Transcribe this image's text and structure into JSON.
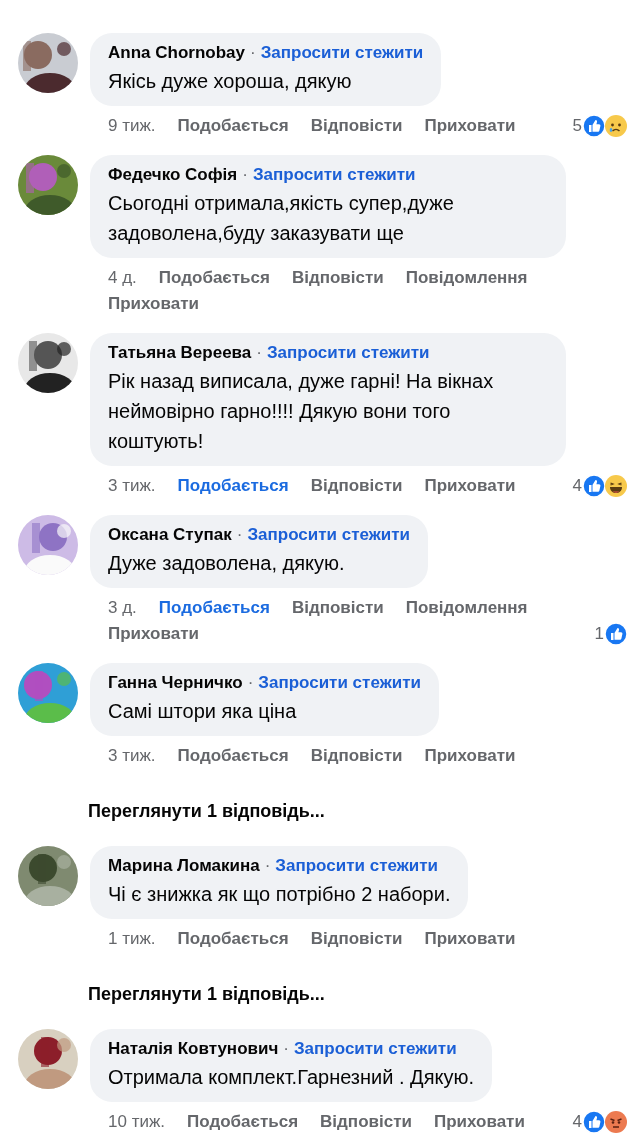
{
  "comments": [
    {
      "author": "Anna Chornobay",
      "separator": "·",
      "follow": "Запросити стежити",
      "text": "Якісь дуже хороша, дякую",
      "time": "9 тиж.",
      "liked": false,
      "actions": [
        {
          "kind": "like",
          "label": "Подобається"
        },
        {
          "kind": "reply",
          "label": "Відповісти"
        },
        {
          "kind": "hide",
          "label": "Приховати"
        }
      ],
      "reactions": {
        "count": "5",
        "icons": [
          {
            "kind": "like"
          },
          {
            "kind": "sad"
          }
        ]
      }
    },
    {
      "author": "Федечко Софія",
      "separator": "·",
      "follow": "Запросити стежити",
      "text": "Сьогодні отримала,якість супер,дуже задоволена,буду заказувати ще",
      "time": "4 д.",
      "liked": false,
      "actions": [
        {
          "kind": "like",
          "label": "Подобається"
        },
        {
          "kind": "reply",
          "label": "Відповісти"
        },
        {
          "kind": "message",
          "label": "Повідомлення"
        },
        {
          "kind": "hide",
          "label": "Приховати"
        }
      ]
    },
    {
      "author": "Татьяна Вереева",
      "separator": "·",
      "follow": "Запросити стежити",
      "text": "Рік назад виписала, дуже гарні! На вікнах неймовірно гарно!!!! Дякую вони того коштують!",
      "time": "3 тиж.",
      "liked": true,
      "actions": [
        {
          "kind": "like",
          "label": "Подобається"
        },
        {
          "kind": "reply",
          "label": "Відповісти"
        },
        {
          "kind": "hide",
          "label": "Приховати"
        }
      ],
      "reactions": {
        "count": "4",
        "icons": [
          {
            "kind": "like"
          },
          {
            "kind": "haha"
          }
        ]
      }
    },
    {
      "author": "Оксана Ступак",
      "separator": "·",
      "follow": "Запросити стежити",
      "text": "Дуже задоволена, дякую.",
      "time": "3 д.",
      "liked": true,
      "actions": [
        {
          "kind": "like",
          "label": "Подобається"
        },
        {
          "kind": "reply",
          "label": "Відповісти"
        },
        {
          "kind": "message",
          "label": "Повідомлення"
        },
        {
          "kind": "hide",
          "label": "Приховати"
        }
      ],
      "reactions": {
        "count": "1",
        "icons": [
          {
            "kind": "like"
          }
        ]
      }
    },
    {
      "author": "Ганна Черничко",
      "separator": "·",
      "follow": "Запросити стежити",
      "text": "Самі штори яка ціна",
      "time": "3 тиж.",
      "liked": false,
      "actions": [
        {
          "kind": "like",
          "label": "Подобається"
        },
        {
          "kind": "reply",
          "label": "Відповісти"
        },
        {
          "kind": "hide",
          "label": "Приховати"
        }
      ],
      "view_replies": "Переглянути 1 відповідь..."
    },
    {
      "author": "Марина Ломакина",
      "separator": "·",
      "follow": "Запросити стежити",
      "text": "Чі є знижка як що потрібно 2 набори.",
      "time": "1 тиж.",
      "liked": false,
      "actions": [
        {
          "kind": "like",
          "label": "Подобається"
        },
        {
          "kind": "reply",
          "label": "Відповісти"
        },
        {
          "kind": "hide",
          "label": "Приховати"
        }
      ],
      "view_replies": "Переглянути 1 відповідь..."
    },
    {
      "author": "Наталія Ковтунович",
      "separator": "·",
      "follow": "Запросити стежити",
      "text": "Отримала комплект.Гарнезний . Дякую.",
      "time": "10 тиж.",
      "liked": false,
      "actions": [
        {
          "kind": "like",
          "label": "Подобається"
        },
        {
          "kind": "reply",
          "label": "Відповісти"
        },
        {
          "kind": "hide",
          "label": "Приховати"
        }
      ],
      "reactions": {
        "count": "4",
        "icons": [
          {
            "kind": "like"
          },
          {
            "kind": "angry"
          }
        ]
      }
    }
  ]
}
